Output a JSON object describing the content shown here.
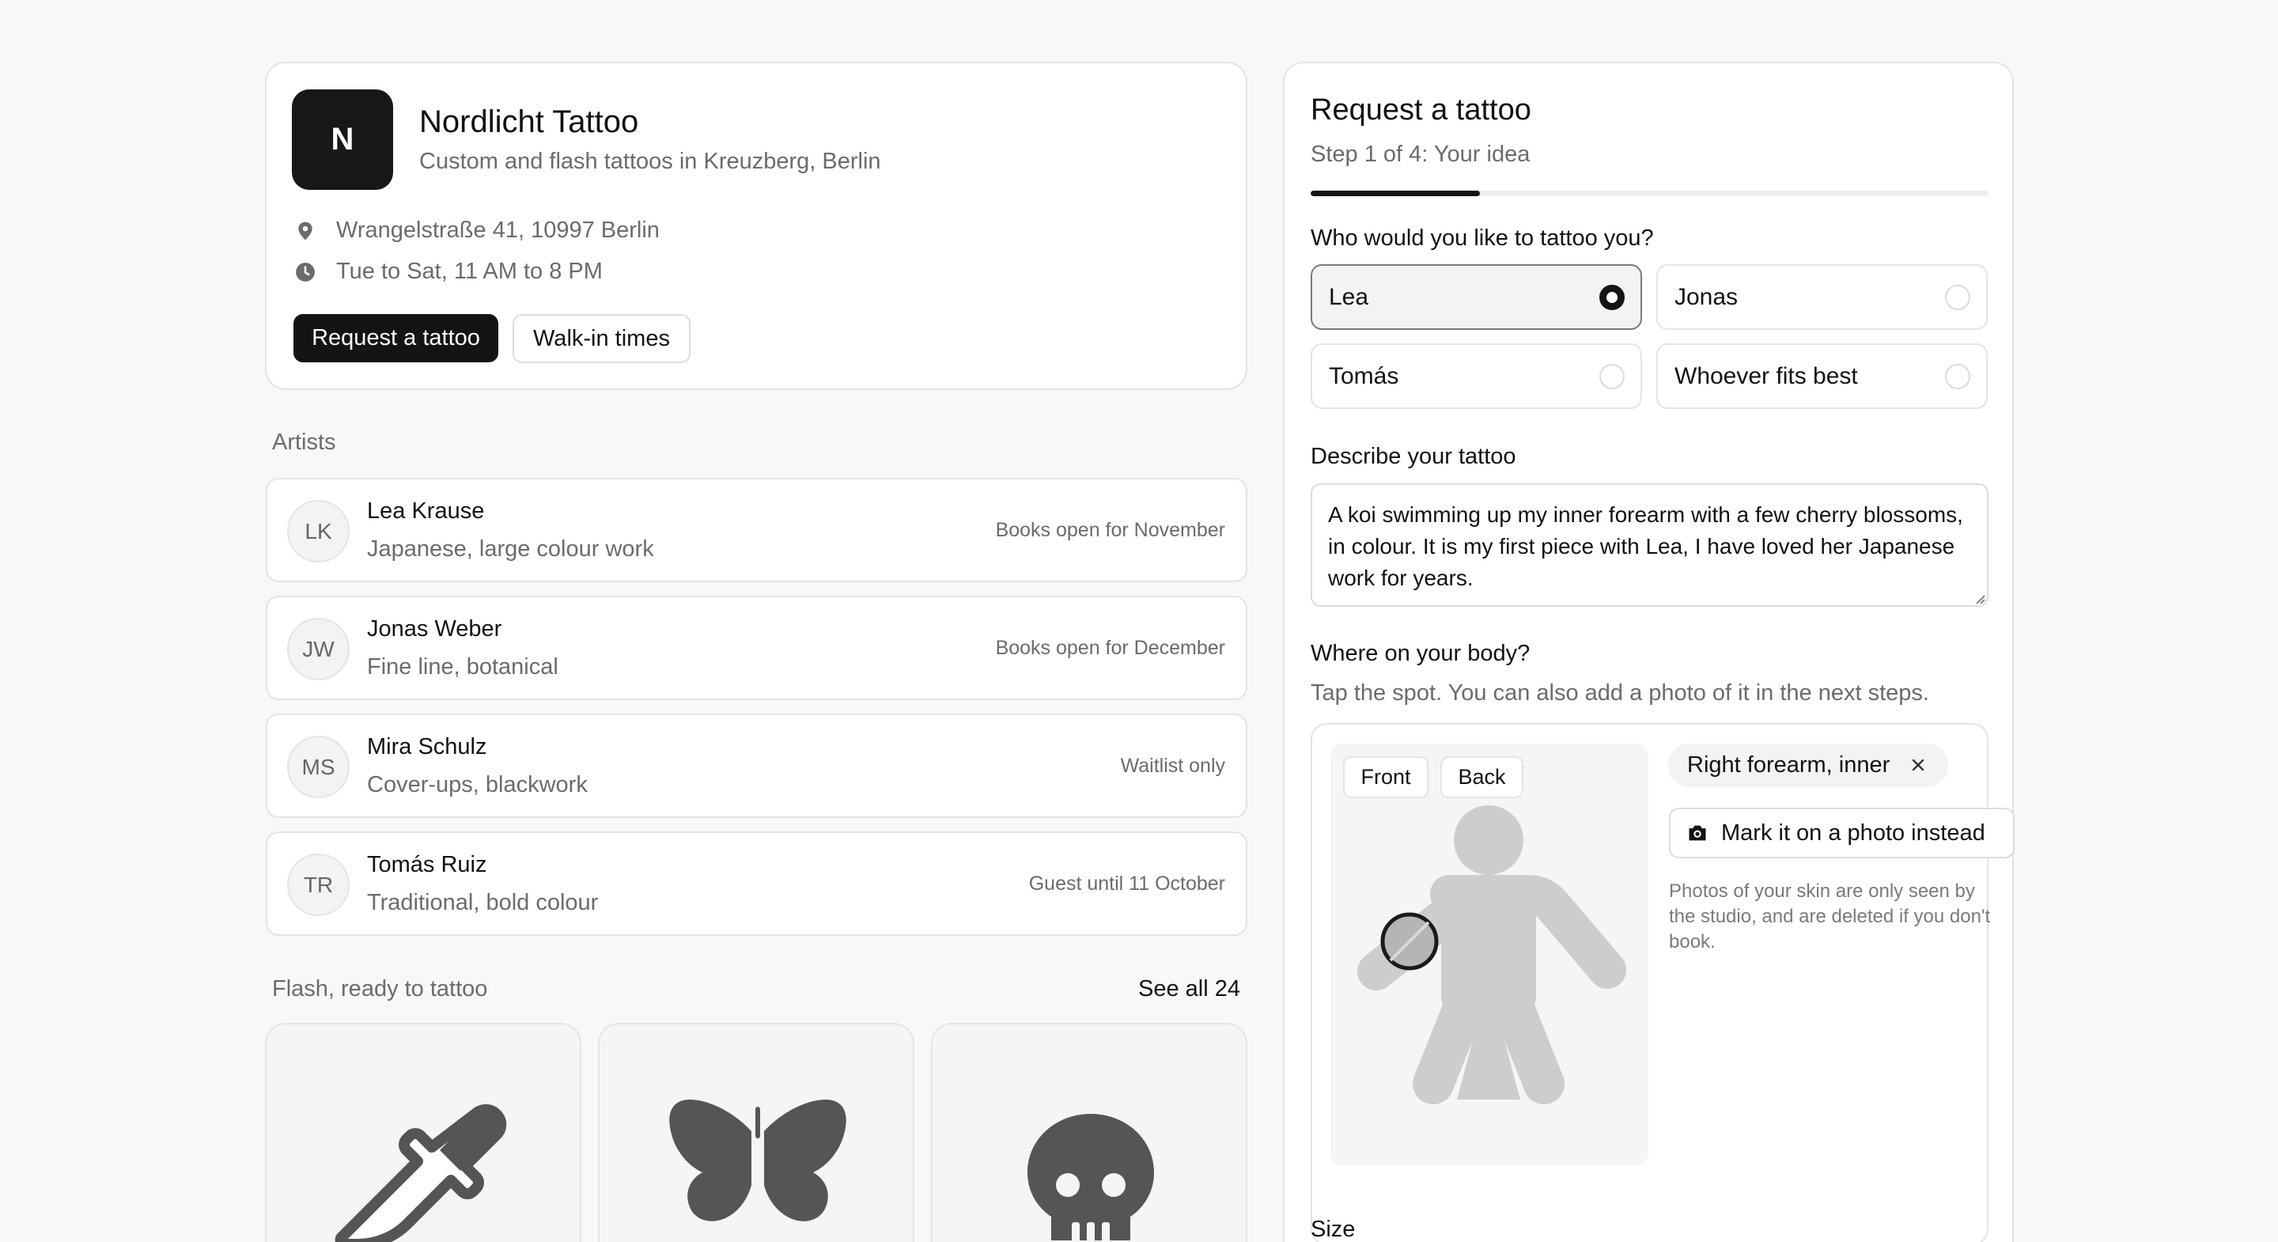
{
  "studio": {
    "logo_letter": "N",
    "name": "Nordlicht Tattoo",
    "tagline": "Custom and flash tattoos in Kreuzberg, Berlin",
    "address": "Wrangelstraße 41, 10997 Berlin",
    "hours": "Tue to Sat, 11 AM to 8 PM",
    "primary_action": "Request a tattoo",
    "secondary_action": "Walk-in times"
  },
  "artists": {
    "label": "Artists",
    "items": [
      {
        "initials": "LK",
        "name": "Lea Krause",
        "style": "Japanese, large colour work",
        "status": "Books open for November"
      },
      {
        "initials": "JW",
        "name": "Jonas Weber",
        "style": "Fine line, botanical",
        "status": "Books open for December"
      },
      {
        "initials": "MS",
        "name": "Mira Schulz",
        "style": "Cover-ups, blackwork",
        "status": "Waitlist only"
      },
      {
        "initials": "TR",
        "name": "Tomás Ruiz",
        "style": "Traditional, bold colour",
        "status": "Guest until 11 October"
      }
    ]
  },
  "flash": {
    "label": "Flash, ready to tattoo",
    "see_all": "See all 24",
    "items": [
      {
        "icon": "dagger-icon"
      },
      {
        "icon": "butterfly-icon"
      },
      {
        "icon": "skull-icon"
      }
    ]
  },
  "request": {
    "title": "Request a tattoo",
    "step": "Step 1 of 4: Your idea",
    "progress_fraction": 0.25,
    "artist_question": "Who would you like to tattoo you?",
    "artist_options": [
      {
        "label": "Lea",
        "selected": true
      },
      {
        "label": "Jonas",
        "selected": false
      },
      {
        "label": "Tomás",
        "selected": false
      },
      {
        "label": "Whoever fits best",
        "selected": false
      }
    ],
    "describe_label": "Describe your tattoo",
    "description": "A koi swimming up my inner forearm with a few cherry blossoms, in colour. It is my first piece with Lea, I have loved her Japanese work for years.",
    "placement_label": "Where on your body?",
    "placement_help": "Tap the spot. You can also add a photo of it in the next steps.",
    "view_front": "Front",
    "view_back": "Back",
    "selected_spot": "Right forearm, inner",
    "photo_action": "Mark it on a photo instead",
    "privacy_note": "Photos of your skin are only seen by the studio, and are deleted if you don't book.",
    "size_label": "Size"
  },
  "colors": {
    "accent": "#141414",
    "muted_text": "#6b6b6b",
    "border": "#e4e4e4",
    "page_bg": "#f8f8f8"
  }
}
